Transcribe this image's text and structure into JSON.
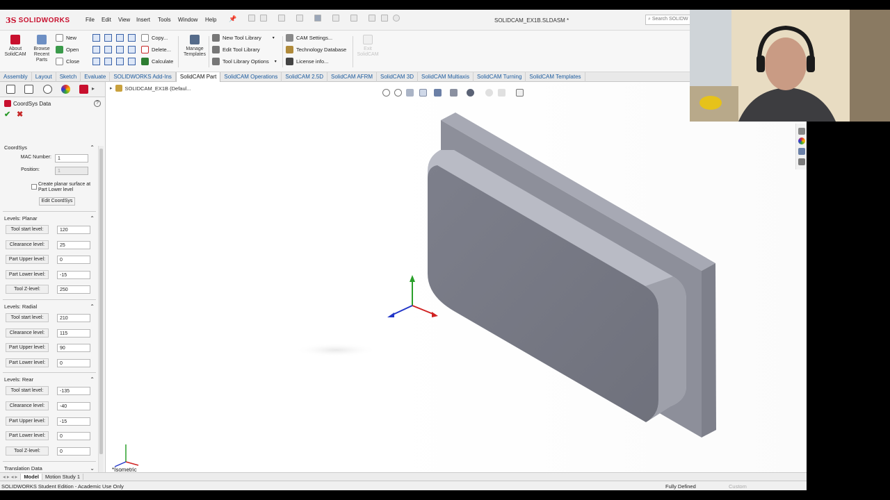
{
  "app": {
    "brand": "SOLIDWORKS",
    "document_title": "SOLIDCAM_EX1B.SLDASM *",
    "search_placeholder": "Search SOLIDW"
  },
  "menu": [
    "File",
    "Edit",
    "View",
    "Insert",
    "Tools",
    "Window",
    "Help"
  ],
  "ribbon": {
    "about": "About SolidCAM",
    "browse": "Browse Recent Parts",
    "file_cmds": [
      "New",
      "Open",
      "Close"
    ],
    "edit_cmds": [
      "Copy...",
      "Delete...",
      "Calculate"
    ],
    "manage_templates": "Manage Templates",
    "tool_cmds": [
      "New Tool Library",
      "Edit Tool Library",
      "Tool Library Options"
    ],
    "settings_cmds": [
      "CAM Settings...",
      "Technology Database",
      "License info..."
    ],
    "exit": "Exit SolidCAM"
  },
  "tabs": [
    "Assembly",
    "Layout",
    "Sketch",
    "Evaluate",
    "SOLIDWORKS Add-Ins",
    "SolidCAM Part",
    "SolidCAM Operations",
    "SolidCAM 2.5D",
    "SolidCAM AFRM",
    "SolidCAM 3D",
    "SolidCAM Multiaxis",
    "SolidCAM Turning",
    "SolidCAM Templates"
  ],
  "active_tab": "SolidCAM Part",
  "property_manager": {
    "title": "CoordSys Data",
    "coordsys": {
      "header": "CoordSys",
      "mac_label": "MAC Number:",
      "mac_value": "1",
      "pos_label": "Position:",
      "pos_value": "1",
      "checkbox_label": "Create planar surface at Part Lower level",
      "edit_button": "Edit CoordSys"
    },
    "planar": {
      "header": "Levels: Planar",
      "rows": [
        {
          "label": "Tool start level:",
          "value": "120"
        },
        {
          "label": "Clearance level:",
          "value": "25"
        },
        {
          "label": "Part Upper level:",
          "value": "0"
        },
        {
          "label": "Part Lower level:",
          "value": "-15"
        },
        {
          "label": "Tool Z-level:",
          "value": "250"
        }
      ]
    },
    "radial": {
      "header": "Levels: Radial",
      "rows": [
        {
          "label": "Tool start level:",
          "value": "210"
        },
        {
          "label": "Clearance level:",
          "value": "115"
        },
        {
          "label": "Part Upper level:",
          "value": "90"
        },
        {
          "label": "Part Lower level:",
          "value": "0"
        }
      ]
    },
    "rear": {
      "header": "Levels: Rear",
      "rows": [
        {
          "label": "Tool start level:",
          "value": "-135"
        },
        {
          "label": "Clearance level:",
          "value": "-40"
        },
        {
          "label": "Part Upper level:",
          "value": "-15"
        },
        {
          "label": "Part Lower level:",
          "value": "0"
        },
        {
          "label": "Tool Z-level:",
          "value": "0"
        }
      ]
    },
    "translation": {
      "header": "Translation Data"
    }
  },
  "viewport": {
    "tree_item": "SOLIDCAM_EX1B  (Defaul...",
    "view_name": "*Isometric"
  },
  "bottom_tabs": [
    "Model",
    "Motion Study 1"
  ],
  "status": {
    "left": "SOLIDWORKS Student Edition - Academic Use Only",
    "state": "Fully Defined",
    "units": "Custom"
  },
  "colors": {
    "brand_red": "#c8102e",
    "tab_blue": "#1a5a9e",
    "part_face": "#7a7c88",
    "part_dark": "#5e606b"
  }
}
